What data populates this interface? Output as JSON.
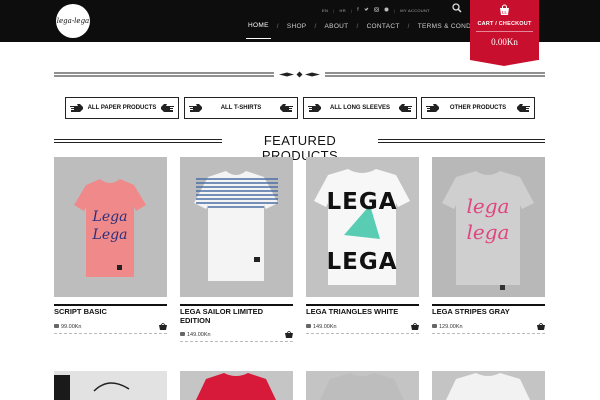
{
  "brand": {
    "logo_text": "lega-lega"
  },
  "topbar": {
    "lang_en": "EN",
    "lang_hr": "HR",
    "my_account": "MY ACCOUNT"
  },
  "nav": [
    "HOME",
    "SHOP",
    "ABOUT",
    "CONTACT",
    "TERMS & CONDITIONS"
  ],
  "cart": {
    "label": "CART / CHECKOUT",
    "amount": "0.00Kn"
  },
  "categories": [
    "ALL PAPER PRODUCTS",
    "ALL T-SHIRTS",
    "ALL LONG SLEEVES",
    "OTHER PRODUCTS"
  ],
  "featured_title": "FEATURED PRODUCTS",
  "products": [
    {
      "name": "SCRIPT BASIC",
      "price": "99.00Kn",
      "shirt_color": "#f08a8a",
      "print": "Lega Lega"
    },
    {
      "name": "LEGA SAILOR LIMITED EDITION",
      "price": "149.00Kn",
      "shirt_color": "#ffffff",
      "print": ""
    },
    {
      "name": "LEGA TRIANGLES WHITE",
      "price": "149.00Kn",
      "shirt_color": "#ffffff",
      "print": "LEGALEGA"
    },
    {
      "name": "LEGA STRIPES GRAY",
      "price": "129.00Kn",
      "shirt_color": "#c9c9c9",
      "print": "lega lega"
    }
  ],
  "colors": {
    "header_bg": "#0d0d0d",
    "cart_red": "#c8102e",
    "photo_bg": "#bdbdbd"
  }
}
